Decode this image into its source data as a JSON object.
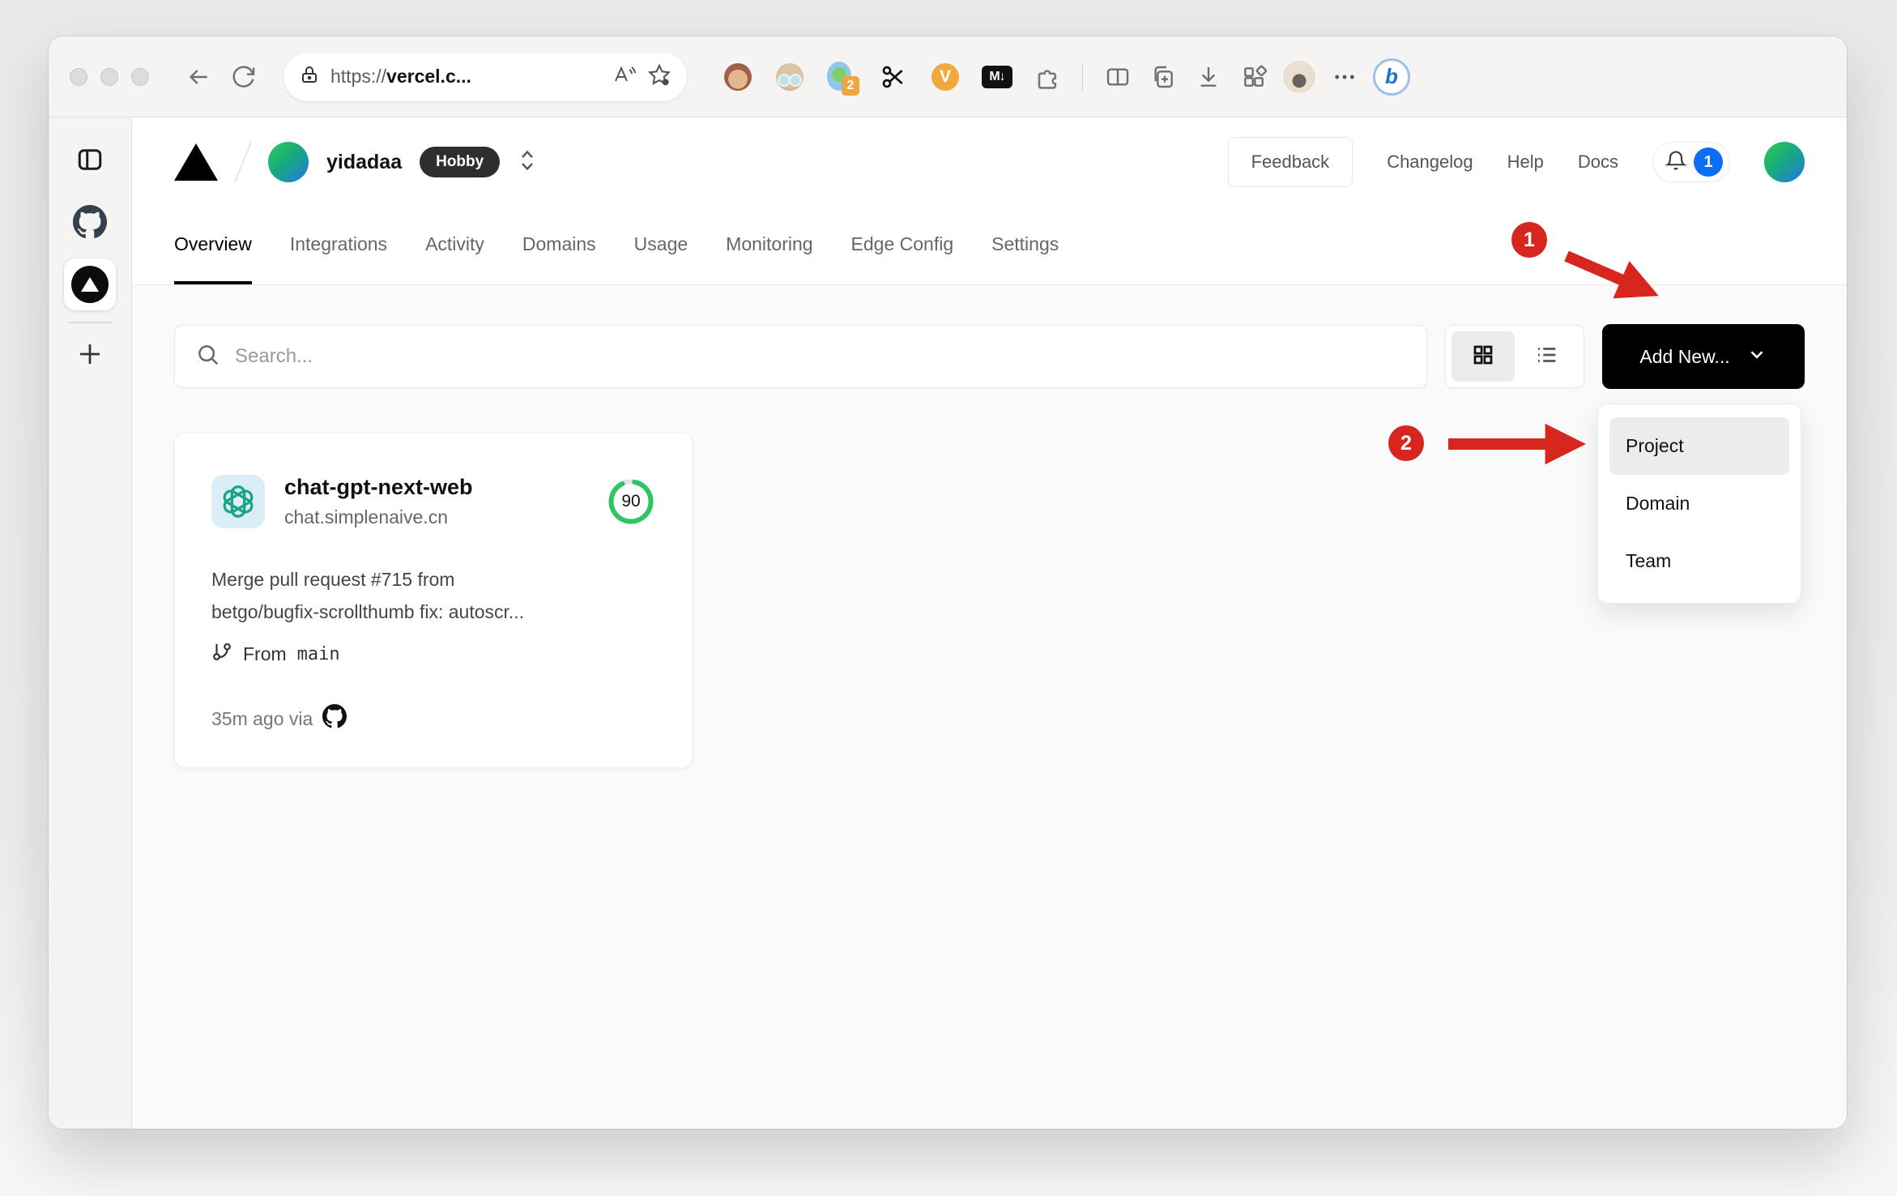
{
  "browser": {
    "url": {
      "prefix": "https://",
      "domain": "vercel.c..."
    },
    "extensions": {
      "badge_count": "2",
      "v_label": "V",
      "markdown_label": "M↓",
      "bing_label": "b"
    }
  },
  "vercel": {
    "header": {
      "team": "yidadaa",
      "plan": "Hobby",
      "feedback": "Feedback",
      "changelog": "Changelog",
      "help": "Help",
      "docs": "Docs",
      "notification_count": "1"
    },
    "tabs": [
      {
        "label": "Overview"
      },
      {
        "label": "Integrations"
      },
      {
        "label": "Activity"
      },
      {
        "label": "Domains"
      },
      {
        "label": "Usage"
      },
      {
        "label": "Monitoring"
      },
      {
        "label": "Edge Config"
      },
      {
        "label": "Settings"
      }
    ],
    "toolbar": {
      "search_placeholder": "Search...",
      "add_new": "Add New..."
    },
    "dropdown": {
      "items": [
        {
          "label": "Project"
        },
        {
          "label": "Domain"
        },
        {
          "label": "Team"
        }
      ]
    },
    "project": {
      "name": "chat-gpt-next-web",
      "domain": "chat.simplenaive.cn",
      "score": "90",
      "commit_line1": "Merge pull request #715 from",
      "commit_line2": "betgo/bugfix-scrollthumb fix: autoscr...",
      "from_label": "From",
      "branch": "main",
      "time": "35m ago via"
    }
  },
  "annotations": {
    "step1": "1",
    "step2": "2"
  },
  "colors": {
    "accent_red": "#d7261d",
    "score_green": "#2fc465",
    "badge_blue": "#0b6ef3",
    "button_black": "#000000"
  }
}
